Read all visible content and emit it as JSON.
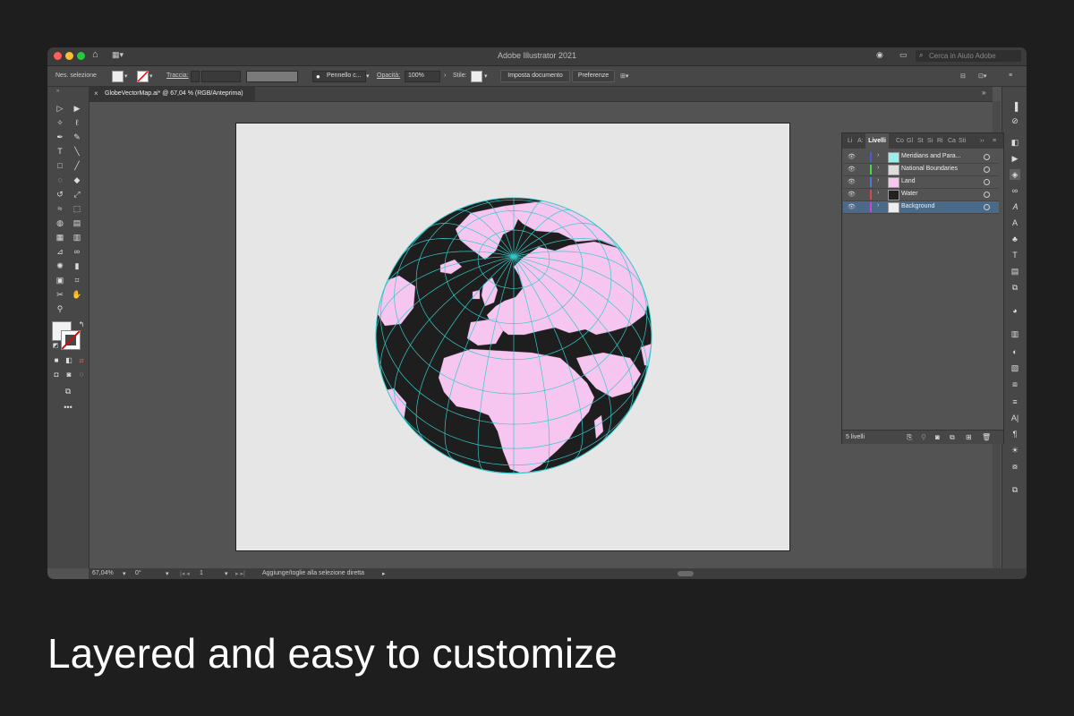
{
  "window": {
    "title": "Adobe Illustrator 2021",
    "search_placeholder": "Cerca in Aiuto Adobe"
  },
  "control_bar": {
    "selection_label": "Nes. selezione",
    "stroke_label": "Traccia:",
    "brush_label": "Pennello c...",
    "opacity_label": "Opacità:",
    "opacity_value": "100%",
    "style_label": "Stile:",
    "document_setup_button": "Imposta documento",
    "preferences_button": "Preferenze"
  },
  "document_tab": {
    "title": "GlobeVectorMap.ai* @ 67,04 % (RGB/Anteprima)"
  },
  "status_bar": {
    "zoom": "67,04%",
    "rotation": "0°",
    "artboard_number": "1",
    "status_text": "Aggiunge/toglie alla selezione diretta"
  },
  "layers_panel": {
    "tabs": [
      "Li",
      "A:",
      "Livelli",
      "Co",
      "Gl",
      "St",
      "Si",
      "Ri",
      "Ca",
      "Sti"
    ],
    "active_tab": "Livelli",
    "layers": [
      {
        "name": "Meridians and Para...",
        "color": "#4a5cd6"
      },
      {
        "name": "National Boundaries",
        "color": "#4ad64a"
      },
      {
        "name": "Land",
        "color": "#4a7ad6"
      },
      {
        "name": "Water",
        "color": "#d64a4a"
      },
      {
        "name": "Background",
        "color": "#c24ad6"
      }
    ],
    "selected_layer": "Background",
    "layer_count": "5 livelli"
  },
  "globe": {
    "land_color": "#f7c6f0",
    "water_color": "#1e1e1e",
    "graticule_color": "#35c9c9"
  },
  "caption": "Layered and easy to customize"
}
